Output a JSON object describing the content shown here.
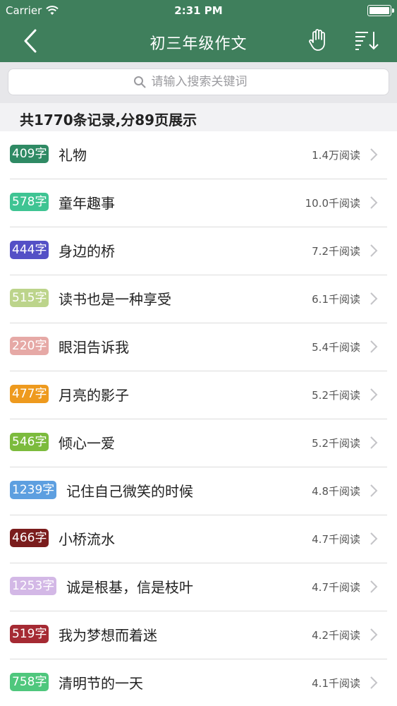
{
  "status": {
    "carrier": "Carrier",
    "time": "2:31 PM"
  },
  "nav": {
    "title": "初三年级作文",
    "back_icon": "chevron-left-icon",
    "hand_icon": "hand-icon",
    "sort_icon": "sort-icon"
  },
  "search": {
    "placeholder": "请输入搜索关键词"
  },
  "summary": "共1770条记录,分89页展示",
  "colors": {
    "header": "#3f7f5c"
  },
  "items": [
    {
      "badge": "409字",
      "color": "#2f8a64",
      "title": "礼物",
      "reads": "1.4万阅读"
    },
    {
      "badge": "578字",
      "color": "#3fc493",
      "title": "童年趣事",
      "reads": "10.0千阅读"
    },
    {
      "badge": "444字",
      "color": "#5450c6",
      "title": "身边的桥",
      "reads": "7.2千阅读"
    },
    {
      "badge": "515字",
      "color": "#bcd48b",
      "title": "读书也是一种享受",
      "reads": "6.1千阅读"
    },
    {
      "badge": "220字",
      "color": "#e6a9a6",
      "title": "眼泪告诉我",
      "reads": "5.4千阅读"
    },
    {
      "badge": "477字",
      "color": "#ee9a1e",
      "title": "月亮的影子",
      "reads": "5.2千阅读"
    },
    {
      "badge": "546字",
      "color": "#7cbb3d",
      "title": "倾心一爱",
      "reads": "5.2千阅读"
    },
    {
      "badge": "1239字",
      "color": "#5d9fe0",
      "title": "记住自己微笑的时候",
      "reads": "4.8千阅读"
    },
    {
      "badge": "466字",
      "color": "#7a1c1c",
      "title": "小桥流水",
      "reads": "4.7千阅读"
    },
    {
      "badge": "1253字",
      "color": "#d3b8e6",
      "title": "诚是根基，信是枝叶",
      "reads": "4.7千阅读"
    },
    {
      "badge": "519字",
      "color": "#a52a33",
      "title": "我为梦想而着迷",
      "reads": "4.2千阅读"
    },
    {
      "badge": "758字",
      "color": "#4fc77d",
      "title": "清明节的一天",
      "reads": "4.1千阅读"
    }
  ]
}
